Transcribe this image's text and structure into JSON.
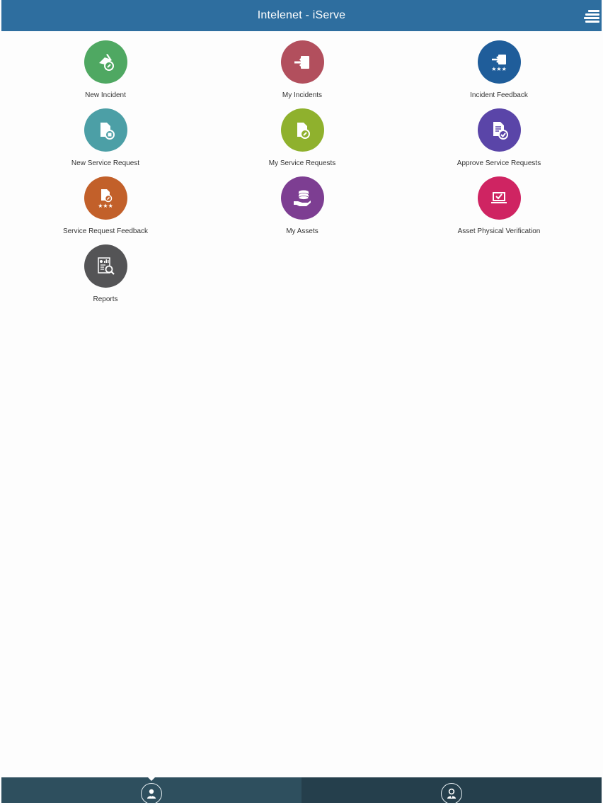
{
  "header": {
    "title": "Intelenet - iServe"
  },
  "tiles": [
    {
      "label": "New Incident",
      "icon": "new-incident-icon",
      "color": "#4fa862"
    },
    {
      "label": "My Incidents",
      "icon": "my-incidents-icon",
      "color": "#b24f5d"
    },
    {
      "label": "Incident Feedback",
      "icon": "incident-feedback-icon",
      "color": "#1f5d9a"
    },
    {
      "label": "New Service Request",
      "icon": "new-service-request-icon",
      "color": "#4c9fa6"
    },
    {
      "label": "My Service Requests",
      "icon": "my-service-requests-icon",
      "color": "#8fb12d"
    },
    {
      "label": "Approve Service Requests",
      "icon": "approve-service-requests-icon",
      "color": "#5a45a8"
    },
    {
      "label": "Service Request Feedback",
      "icon": "service-request-feedback-icon",
      "color": "#c2602a"
    },
    {
      "label": "My Assets",
      "icon": "my-assets-icon",
      "color": "#7d3e92"
    },
    {
      "label": "Asset Physical Verification",
      "icon": "asset-verification-icon",
      "color": "#cf2462"
    },
    {
      "label": "Reports",
      "icon": "reports-icon",
      "color": "#545456"
    }
  ],
  "bottom_tabs": [
    {
      "name": "user-tab",
      "icon": "user-icon",
      "active": true
    },
    {
      "name": "profile-tab",
      "icon": "profile-icon",
      "active": false
    }
  ]
}
